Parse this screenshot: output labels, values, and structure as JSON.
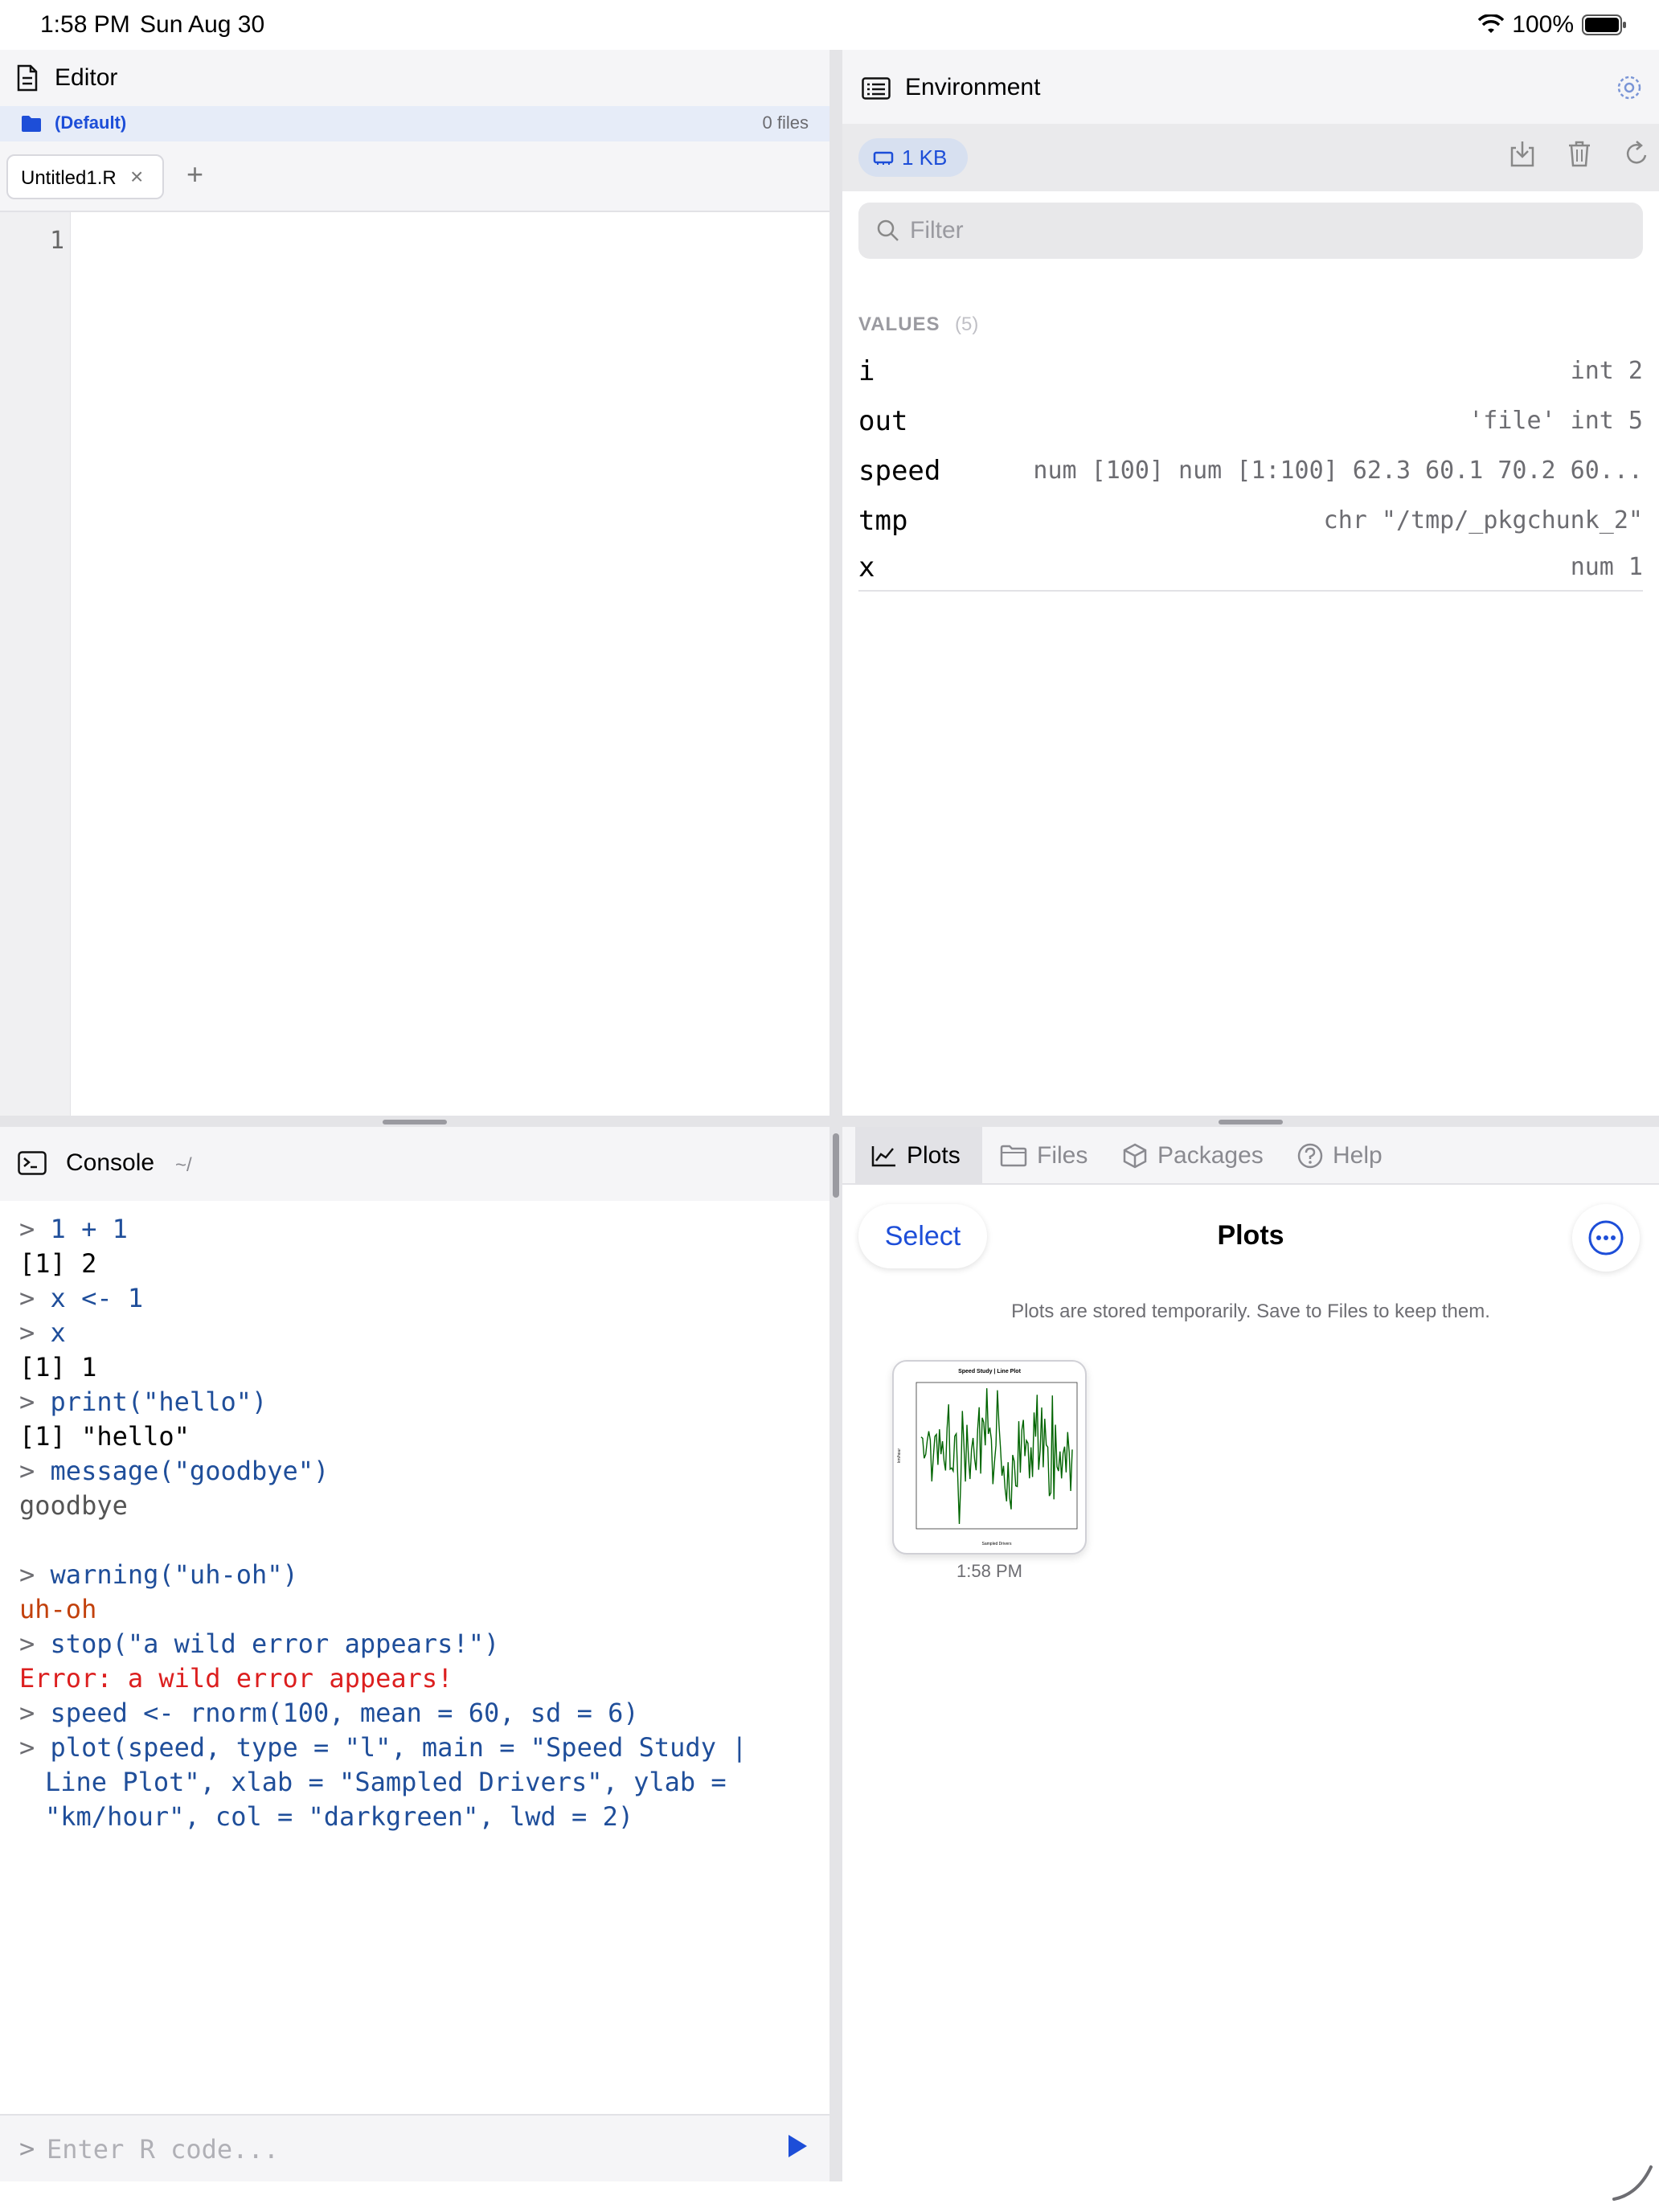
{
  "status_bar": {
    "time": "1:58 PM",
    "date": "Sun Aug 30",
    "battery": "100%"
  },
  "editor": {
    "title": "Editor",
    "project": "(Default)",
    "file_count": "0 files",
    "tab_name": "Untitled1.R",
    "tab_close": "×",
    "add_tab": "+",
    "line_number": "1"
  },
  "console": {
    "title": "Console",
    "path": "~/",
    "placeholder": "Enter R code...",
    "input_prompt": ">",
    "lines": [
      {
        "kind": "cmd",
        "text": "1 + 1"
      },
      {
        "kind": "out",
        "text": "[1] 2"
      },
      {
        "kind": "cmd",
        "text": "x <- 1"
      },
      {
        "kind": "cmd",
        "text": "x"
      },
      {
        "kind": "out",
        "text": "[1] 1"
      },
      {
        "kind": "cmd",
        "text": "print(\"hello\")"
      },
      {
        "kind": "out",
        "text": "[1] \"hello\""
      },
      {
        "kind": "cmd",
        "text": "message(\"goodbye\")"
      },
      {
        "kind": "msg",
        "text": "goodbye"
      },
      {
        "kind": "blank",
        "text": ""
      },
      {
        "kind": "cmd",
        "text": "warning(\"uh-oh\")"
      },
      {
        "kind": "warn",
        "text": "uh-oh"
      },
      {
        "kind": "cmd",
        "text": "stop(\"a wild error appears!\")"
      },
      {
        "kind": "err",
        "text": "Error: a wild error appears!"
      },
      {
        "kind": "cmd",
        "text": "speed <- rnorm(100, mean = 60, sd = 6)"
      },
      {
        "kind": "cmd",
        "text": "plot(speed, type = \"l\", main = \"Speed Study |"
      },
      {
        "kind": "cont",
        "text": "Line Plot\", xlab = \"Sampled Drivers\", ylab ="
      },
      {
        "kind": "cont",
        "text": "\"km/hour\", col = \"darkgreen\", lwd = 2)"
      }
    ]
  },
  "environment": {
    "title": "Environment",
    "memory": "1 KB",
    "filter_placeholder": "Filter",
    "values_label": "VALUES",
    "values_count": "(5)",
    "rows": [
      {
        "name": "i",
        "desc": "int 2"
      },
      {
        "name": "out",
        "desc": "'file' int 5"
      },
      {
        "name": "speed",
        "desc": "num [100]  num [1:100] 62.3 60.1 70.2 60..."
      },
      {
        "name": "tmp",
        "desc": "chr \"/tmp/_pkgchunk_2\""
      },
      {
        "name": "x",
        "desc": "num 1"
      }
    ]
  },
  "plots": {
    "tabs": [
      "Plots",
      "Files",
      "Packages",
      "Help"
    ],
    "select_label": "Select",
    "title": "Plots",
    "note": "Plots are stored temporarily. Save to Files to keep them.",
    "thumb_time": "1:58 PM",
    "thumb_plot_title": "Speed Study | Line Plot",
    "thumb_xlabel": "Sampled Drivers",
    "thumb_ylabel": "km/hour",
    "line_color": "#006400"
  },
  "colors": {
    "accent": "#1d4ed8",
    "run_green": "#34a853",
    "error": "#dc1f1f",
    "warning": "#c2410c"
  }
}
